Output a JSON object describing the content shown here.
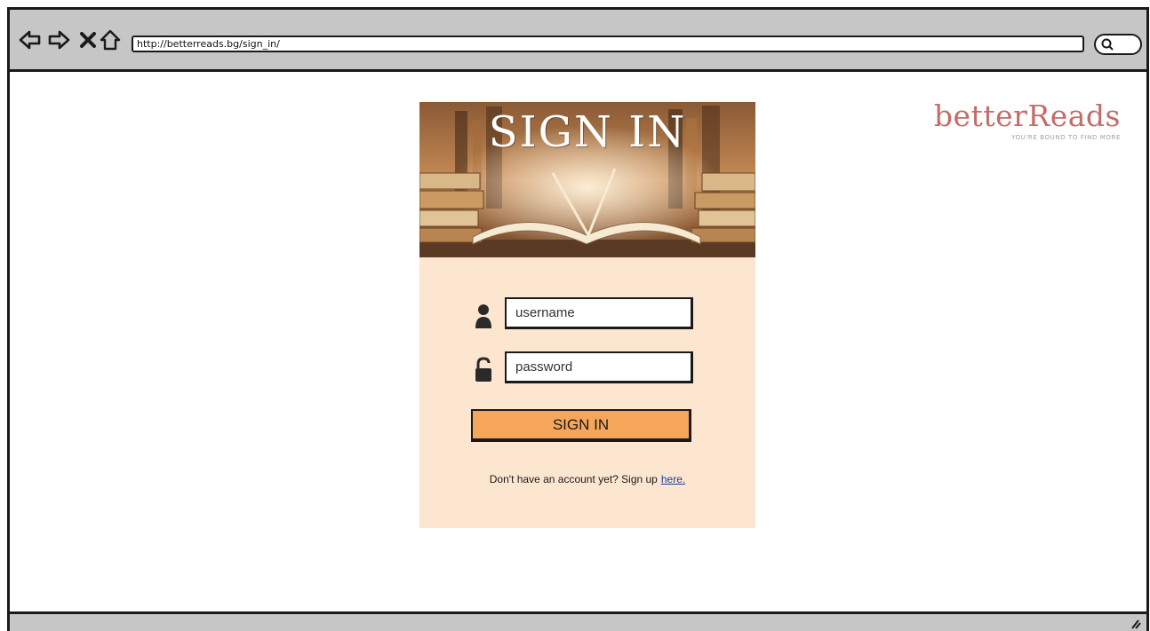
{
  "browser": {
    "url": "http://betterreads.bg/sign_in/",
    "nav_icons": [
      "back-arrow-icon",
      "forward-arrow-icon",
      "close-icon",
      "home-icon"
    ],
    "search_icon": "search-icon"
  },
  "brand": {
    "name": "betterReads",
    "tagline": "YOU'RE BOUND TO FIND MORE",
    "color": "#c26d6a"
  },
  "signin_card": {
    "hero_title": "SIGN IN",
    "username_placeholder": "username",
    "password_placeholder": "password",
    "username_icon": "user-icon",
    "password_icon": "unlock-icon",
    "button_label": "SIGN IN",
    "button_color": "#f5a65b",
    "signup_prompt": "Don't have an account yet?  Sign up",
    "signup_link": "here."
  },
  "colors": {
    "card_bg": "#fde6cf",
    "chrome": "#c6c6c6",
    "link": "#1b3fa0"
  }
}
